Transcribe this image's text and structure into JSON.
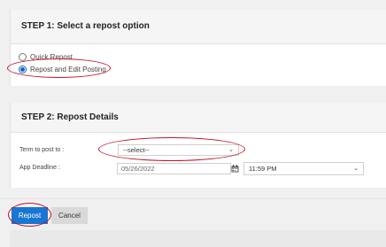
{
  "step1": {
    "title": "STEP 1: Select a repost option",
    "options": [
      {
        "label": "Quick Repost",
        "selected": false
      },
      {
        "label": "Repost and Edit Posting",
        "selected": true
      }
    ]
  },
  "step2": {
    "title": "STEP 2: Repost Details",
    "term_label": "Term to post to :",
    "term_value": "--select--",
    "deadline_label": "App Deadline :",
    "deadline_date": "05/26/2022",
    "deadline_time": "11:59 PM"
  },
  "actions": {
    "repost_label": "Repost",
    "cancel_label": "Cancel"
  },
  "colors": {
    "primary": "#1976d2",
    "annotation": "#c0142b"
  }
}
